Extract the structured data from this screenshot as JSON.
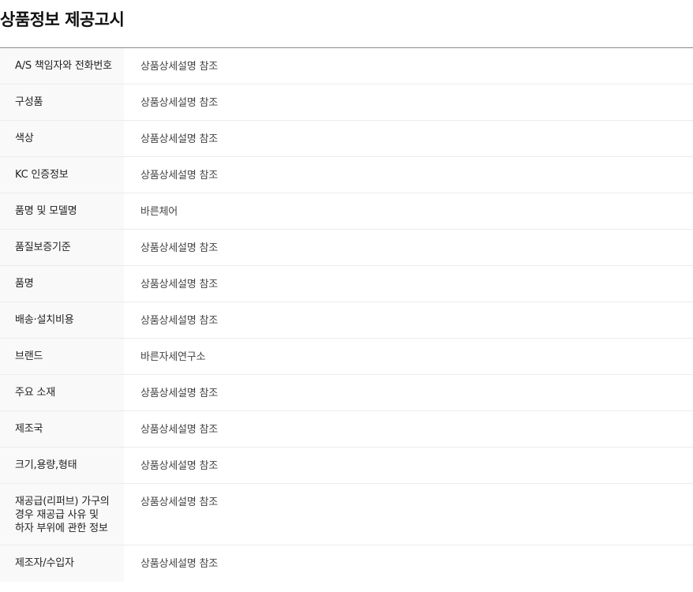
{
  "section": {
    "title": "상품정보 제공고시"
  },
  "rows": [
    {
      "label": "A/S 책임자와 전화번호",
      "value": "상품상세설명 참조"
    },
    {
      "label": "구성품",
      "value": "상품상세설명 참조"
    },
    {
      "label": "색상",
      "value": "상품상세설명 참조"
    },
    {
      "label": "KC 인증정보",
      "value": "상품상세설명 참조"
    },
    {
      "label": "품명 및 모델명",
      "value": "바른체어"
    },
    {
      "label": "품질보증기준",
      "value": "상품상세설명 참조"
    },
    {
      "label": "품명",
      "value": "상품상세설명 참조"
    },
    {
      "label": "배송·설치비용",
      "value": "상품상세설명 참조"
    },
    {
      "label": "브랜드",
      "value": "바른자세연구소"
    },
    {
      "label": "주요 소재",
      "value": "상품상세설명 참조"
    },
    {
      "label": "제조국",
      "value": "상품상세설명 참조"
    },
    {
      "label": "크기,용량,형태",
      "value": "상품상세설명 참조"
    },
    {
      "label": "재공급(리퍼브) 가구의 경우 재공급 사유 및 하자 부위에 관한 정보",
      "value": "상품상세설명 참조"
    },
    {
      "label": "제조자/수입자",
      "value": "상품상세설명 참조"
    }
  ]
}
